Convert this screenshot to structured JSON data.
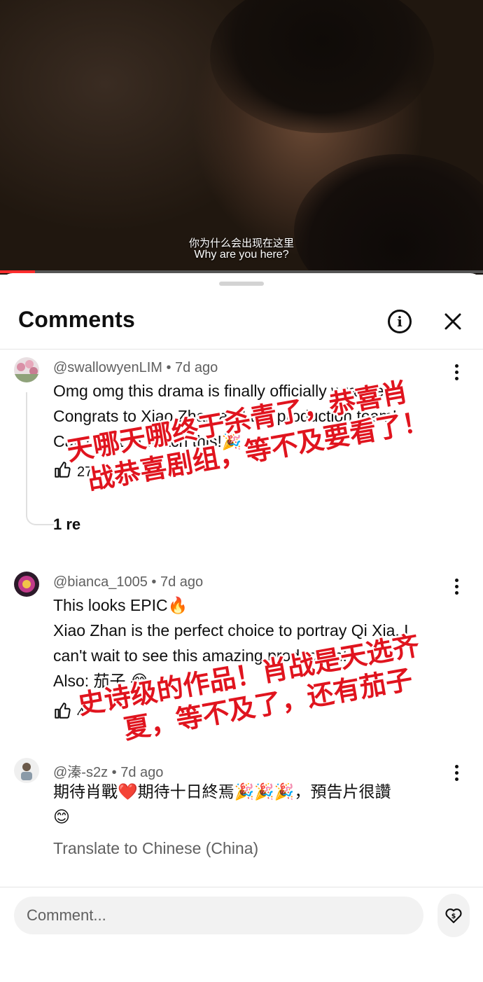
{
  "video": {
    "subtitle_zh": "你为什么会出现在这里",
    "subtitle_en": "Why are you here?",
    "progress": 0.073,
    "progress_color": "#ff2d2d"
  },
  "sheet": {
    "title": "Comments",
    "info_icon": "info-icon",
    "close_icon": "close-icon"
  },
  "comments": [
    {
      "author": "@swallowyenLIM",
      "age": "7d ago",
      "lines": [
        "Omg omg this drama is finally officially wrapped!",
        "Congrats to Xiao Zhan and the production team!",
        "Can't wait to watch this!🎉"
      ],
      "likes": "27",
      "replies_label": "1 re"
    },
    {
      "author": "@bianca_1005",
      "age": "7d ago",
      "lines": [
        "This looks EPIC🔥",
        "Xiao Zhan is the perfect choice to portray Qi Xia, I",
        "can't wait to see this amazing production!",
        "Also: 茄子 😂"
      ],
      "likes": "4"
    },
    {
      "author": "@溱-s2z",
      "age": "7d ago",
      "lines": [
        "期待肖戰❤️期待十日終焉🎉🎉🎉，預告片很讚",
        "😊"
      ],
      "translate_label": "Translate to Chinese (China)"
    }
  ],
  "overlays": [
    {
      "line1": "天哪天哪终于杀青了，恭喜肖",
      "line2": "战恭喜剧组，等不及要看了！"
    },
    {
      "line1": "史诗级的作品！肖战是天选齐",
      "line2": "夏，等不及了，还有茄子"
    }
  ],
  "composer": {
    "placeholder": "Comment...",
    "thanks_icon": "super-thanks-icon"
  },
  "colors": {
    "stamp_red": "#e0141e",
    "meta_gray": "#606060"
  }
}
